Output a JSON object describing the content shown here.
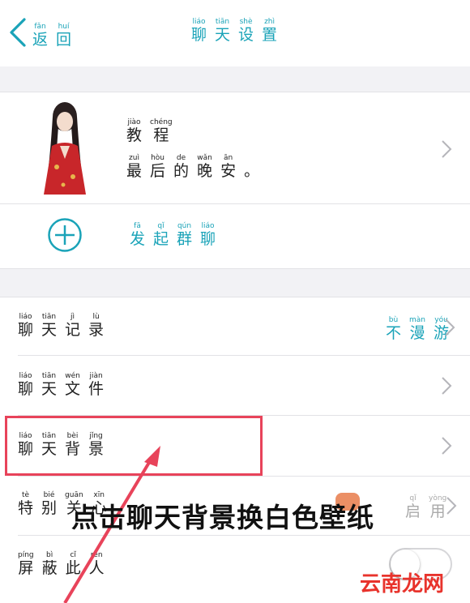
{
  "header": {
    "back": {
      "pinyin": [
        "fǎn",
        "huí"
      ],
      "chars": [
        "返",
        "回"
      ]
    },
    "title": {
      "pinyin": [
        "liáo",
        "tiān",
        "shè",
        "zhì"
      ],
      "chars": [
        "聊",
        "天",
        "设",
        "置"
      ]
    }
  },
  "profile": {
    "name": {
      "pinyin": [
        "jiào",
        "chéng"
      ],
      "chars": [
        "教",
        "程"
      ]
    },
    "message": {
      "pinyin": [
        "zuì",
        "hòu",
        "de",
        "wǎn",
        "ān"
      ],
      "chars": [
        "最",
        "后",
        "的",
        "晚",
        "安",
        "。"
      ]
    }
  },
  "group_chat": {
    "pinyin": [
      "fā",
      "qǐ",
      "qún",
      "liáo"
    ],
    "chars": [
      "发",
      "起",
      "群",
      "聊"
    ]
  },
  "settings": [
    {
      "id": "chat-history",
      "pinyin": [
        "liáo",
        "tiān",
        "jì",
        "lù"
      ],
      "chars": [
        "聊",
        "天",
        "记",
        "录"
      ],
      "value": {
        "pinyin": [
          "bù",
          "màn",
          "yóu"
        ],
        "chars": [
          "不",
          "漫",
          "游"
        ]
      }
    },
    {
      "id": "chat-files",
      "pinyin": [
        "liáo",
        "tiān",
        "wén",
        "jiàn"
      ],
      "chars": [
        "聊",
        "天",
        "文",
        "件"
      ]
    },
    {
      "id": "chat-background",
      "pinyin": [
        "liáo",
        "tiān",
        "bèi",
        "jǐng"
      ],
      "chars": [
        "聊",
        "天",
        "背",
        "景"
      ]
    },
    {
      "id": "special-care",
      "pinyin": [
        "tè",
        "bié",
        "guān",
        "xīn"
      ],
      "chars": [
        "特",
        "别",
        "关",
        "心"
      ],
      "value": {
        "pinyin": [
          "qǐ",
          "yòng"
        ],
        "chars": [
          "启",
          "用"
        ]
      }
    },
    {
      "id": "block-user",
      "pinyin": [
        "píng",
        "bì",
        "cǐ",
        "rén"
      ],
      "chars": [
        "屏",
        "蔽",
        "此",
        "人"
      ]
    }
  ],
  "annotation": "点击聊天背景换白色壁纸",
  "watermark": "云南龙网",
  "colors": {
    "accent": "#1aa3b8",
    "highlight": "#e8435a",
    "watermark": "#e8332c"
  },
  "icons": {
    "back": "chevron-left-icon",
    "add": "plus-circle-icon",
    "row": "chevron-right-icon"
  }
}
